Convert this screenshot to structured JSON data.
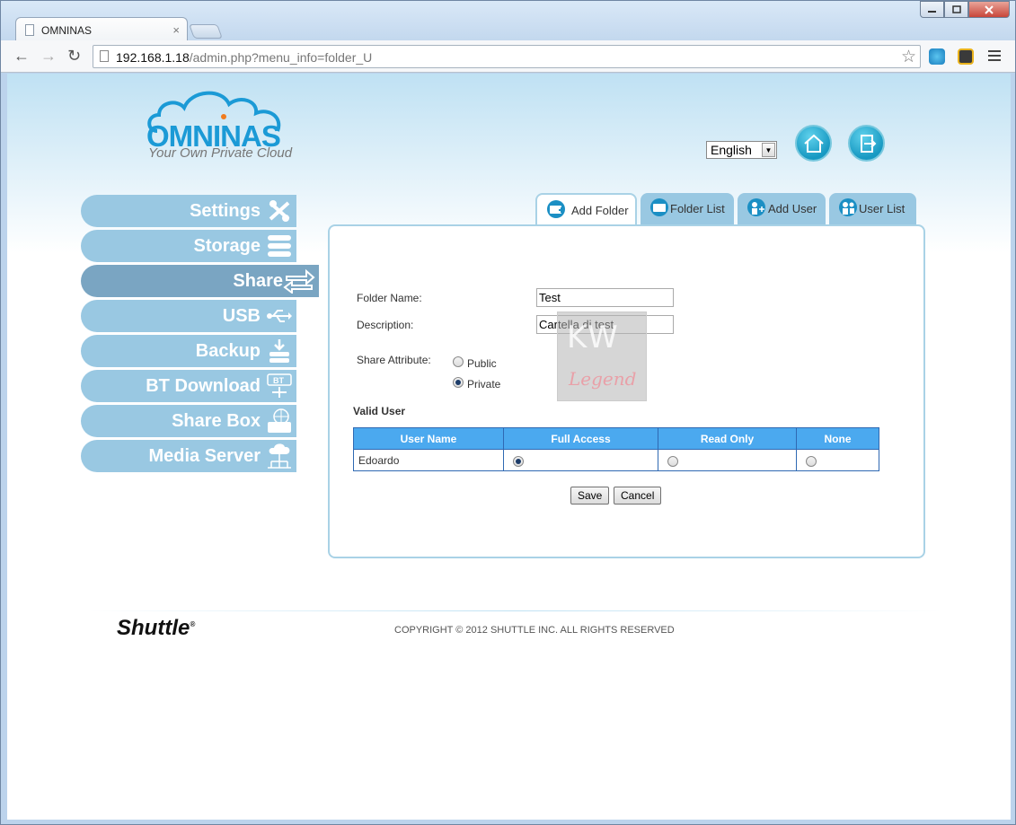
{
  "browser": {
    "tab_title": "OMNINAS",
    "tab_close": "×",
    "url_host": "192.168.1.18",
    "url_path": "/admin.php?menu_info=folder_U",
    "back": "←",
    "forward": "→",
    "reload": "↻",
    "star": "☆"
  },
  "header": {
    "brand": "OMNINAS",
    "tagline": "Your Own Private Cloud",
    "language": "English"
  },
  "sidebar": {
    "items": [
      {
        "label": "Settings",
        "icon": "tools-icon"
      },
      {
        "label": "Storage",
        "icon": "storage-icon"
      },
      {
        "label": "Share",
        "icon": "share-arrows-icon"
      },
      {
        "label": "USB",
        "icon": "usb-icon"
      },
      {
        "label": "Backup",
        "icon": "backup-icon"
      },
      {
        "label": "BT Download",
        "icon": "bt-download-icon"
      },
      {
        "label": "Share Box",
        "icon": "share-box-icon"
      },
      {
        "label": "Media Server",
        "icon": "media-server-icon"
      }
    ],
    "active": "Share"
  },
  "tabs": [
    {
      "label": "Add Folder",
      "icon": "add-folder-icon",
      "active": true
    },
    {
      "label": "Folder List",
      "icon": "folder-list-icon",
      "active": false
    },
    {
      "label": "Add User",
      "icon": "add-user-icon",
      "active": false
    },
    {
      "label": "User List",
      "icon": "user-list-icon",
      "active": false
    }
  ],
  "form": {
    "folder_name_label": "Folder Name:",
    "folder_name_value": "Test",
    "description_label": "Description:",
    "description_value": "Cartella di test",
    "share_attribute_label": "Share Attribute:",
    "option_public": "Public",
    "option_private": "Private",
    "share_attribute_selected": "Private"
  },
  "valid_user": {
    "title": "Valid User",
    "columns": [
      "User Name",
      "Full Access",
      "Read Only",
      "None"
    ],
    "rows": [
      {
        "user": "Edoardo",
        "access": "Full Access"
      }
    ]
  },
  "actions": {
    "save": "Save",
    "cancel": "Cancel"
  },
  "watermark": {
    "text1": "KW",
    "text2": "Legend"
  },
  "footer": {
    "brand": "Shuttle",
    "brand_mark": "®",
    "copyright": "COPYRIGHT © 2012 SHUTTLE INC. ALL RIGHTS RESERVED"
  },
  "colors": {
    "sidebar": "#99c8e2",
    "sidebar_active": "#7aa5c2",
    "table_header": "#4ba9ef",
    "brand_blue": "#1b9ad6"
  }
}
